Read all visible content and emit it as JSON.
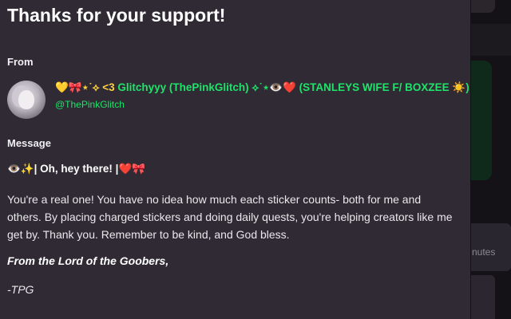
{
  "modal": {
    "title": "Thanks for your support!",
    "from_label": "From",
    "message_label": "Message"
  },
  "sender": {
    "name_prefix": "💛🎀⋆˙⟡ <3 ",
    "name_main": "Glitchyyy (ThePinkGlitch) ⟡˙⋆👁️",
    "name_heart": "❤️",
    "name_suffix": " (STANLEYS WIFE F/ BOXZEE ☀️)",
    "handle": "@ThePinkGlitch",
    "avatar_icon": "avatar-portrait"
  },
  "message": {
    "heading": "👁️✨| Oh, hey there! |❤️🎀",
    "body": "You're a real one! You have no idea how much each sticker counts- both for me and others. By placing charged stickers and doing daily quests, you're helping creators like me get by. Thank you. Remember to be kind, and God bless.",
    "signoff": "From the Lord of the Goobers,",
    "signature": "-TPG"
  },
  "background": {
    "partial_text": "nutes"
  },
  "colors": {
    "modal_bg": "#2f2a33",
    "name_green": "#1fe36a",
    "page_bg": "#141216"
  }
}
